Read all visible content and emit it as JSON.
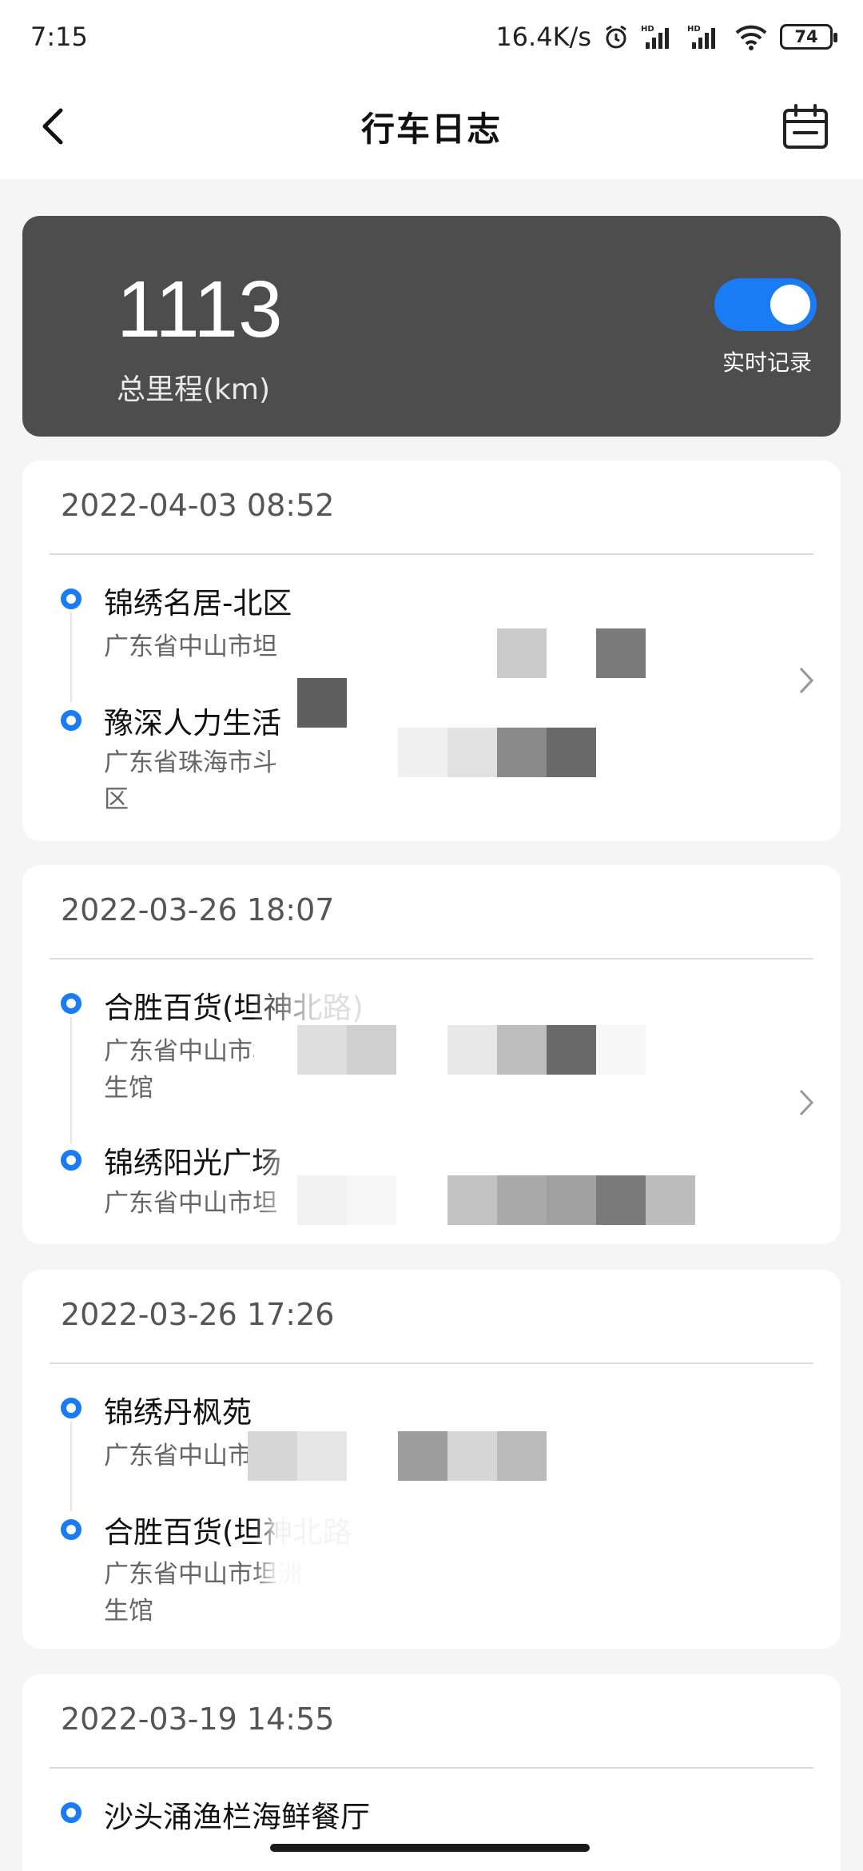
{
  "status": {
    "time": "7:15",
    "speed": "16.4K/s",
    "battery": "74"
  },
  "nav": {
    "title": "行车日志"
  },
  "summary": {
    "total": "1113",
    "label": "总里程(km)",
    "toggle_label": "实时记录",
    "toggle_on": true
  },
  "colors": {
    "accent": "#1a7cf5",
    "summary_bg": "#4d4d4d"
  },
  "trips": [
    {
      "date": "2022-04-03 08:52",
      "start_name": "锦绣名居-北区",
      "start_addr": "广东省中山市坦",
      "end_name": "豫深人力生活",
      "end_addr": "广东省珠海市斗",
      "end_addr2": "区"
    },
    {
      "date": "2022-03-26 18:07",
      "start_name": "合胜百货(坦神北路)",
      "start_addr": "广东省中山市坦",
      "start_addr2": "生馆",
      "end_name": "锦绣阳光广场",
      "end_addr": "广东省中山市坦"
    },
    {
      "date": "2022-03-26 17:26",
      "start_name": "锦绣丹枫苑",
      "start_addr": "广东省中山市",
      "end_name": "合胜百货(坦神北路",
      "end_addr": "广东省中山市坦洲",
      "end_addr2": "生馆"
    },
    {
      "date": "2022-03-19 14:55",
      "start_name": "沙头涌渔栏海鲜餐厅"
    }
  ]
}
